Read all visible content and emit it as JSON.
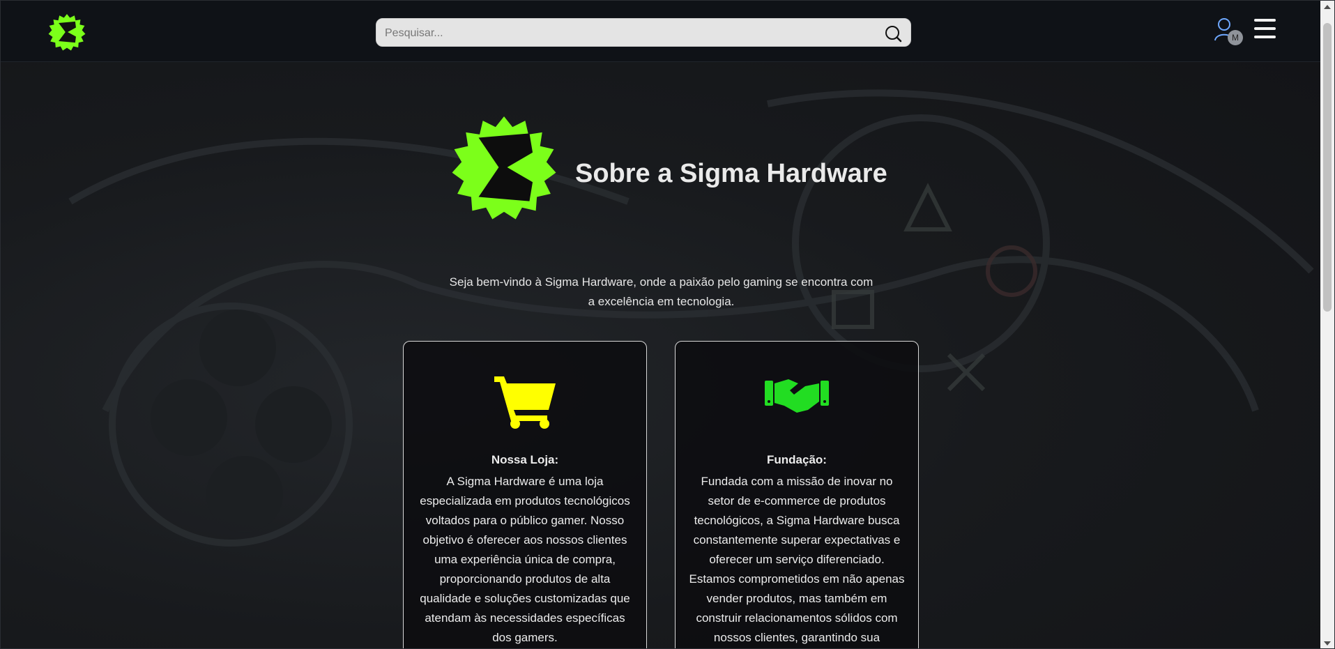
{
  "header": {
    "search": {
      "placeholder": "Pesquisar...",
      "value": ""
    },
    "user": {
      "badge": "M"
    }
  },
  "about": {
    "title": "Sobre a Sigma Hardware",
    "intro": "Seja bem-vindo à Sigma Hardware, onde a paixão pelo gaming se encontra com a excelência em tecnologia."
  },
  "cards": [
    {
      "icon": "shopping-cart-icon",
      "icon_color": "#ffff00",
      "title": "Nossa Loja:",
      "text": "A Sigma Hardware é uma loja especializada em produtos tecnológicos voltados para o público gamer. Nosso objetivo é oferecer aos nossos clientes uma experiência única de compra, proporcionando produtos de alta qualidade e soluções customizadas que atendam às necessidades específicas dos gamers."
    },
    {
      "icon": "handshake-icon",
      "icon_color": "#22dd22",
      "title": "Fundação:",
      "text": "Fundada com a missão de inovar no setor de e-commerce de produtos tecnológicos, a Sigma Hardware busca constantemente superar expectativas e oferecer um serviço diferenciado. Estamos comprometidos em não apenas vender produtos, mas também em construir relacionamentos sólidos com nossos clientes, garantindo sua"
    }
  ],
  "colors": {
    "brand_green": "#7cff1a",
    "header_bg": "#0f1217",
    "page_bg": "#141519"
  }
}
